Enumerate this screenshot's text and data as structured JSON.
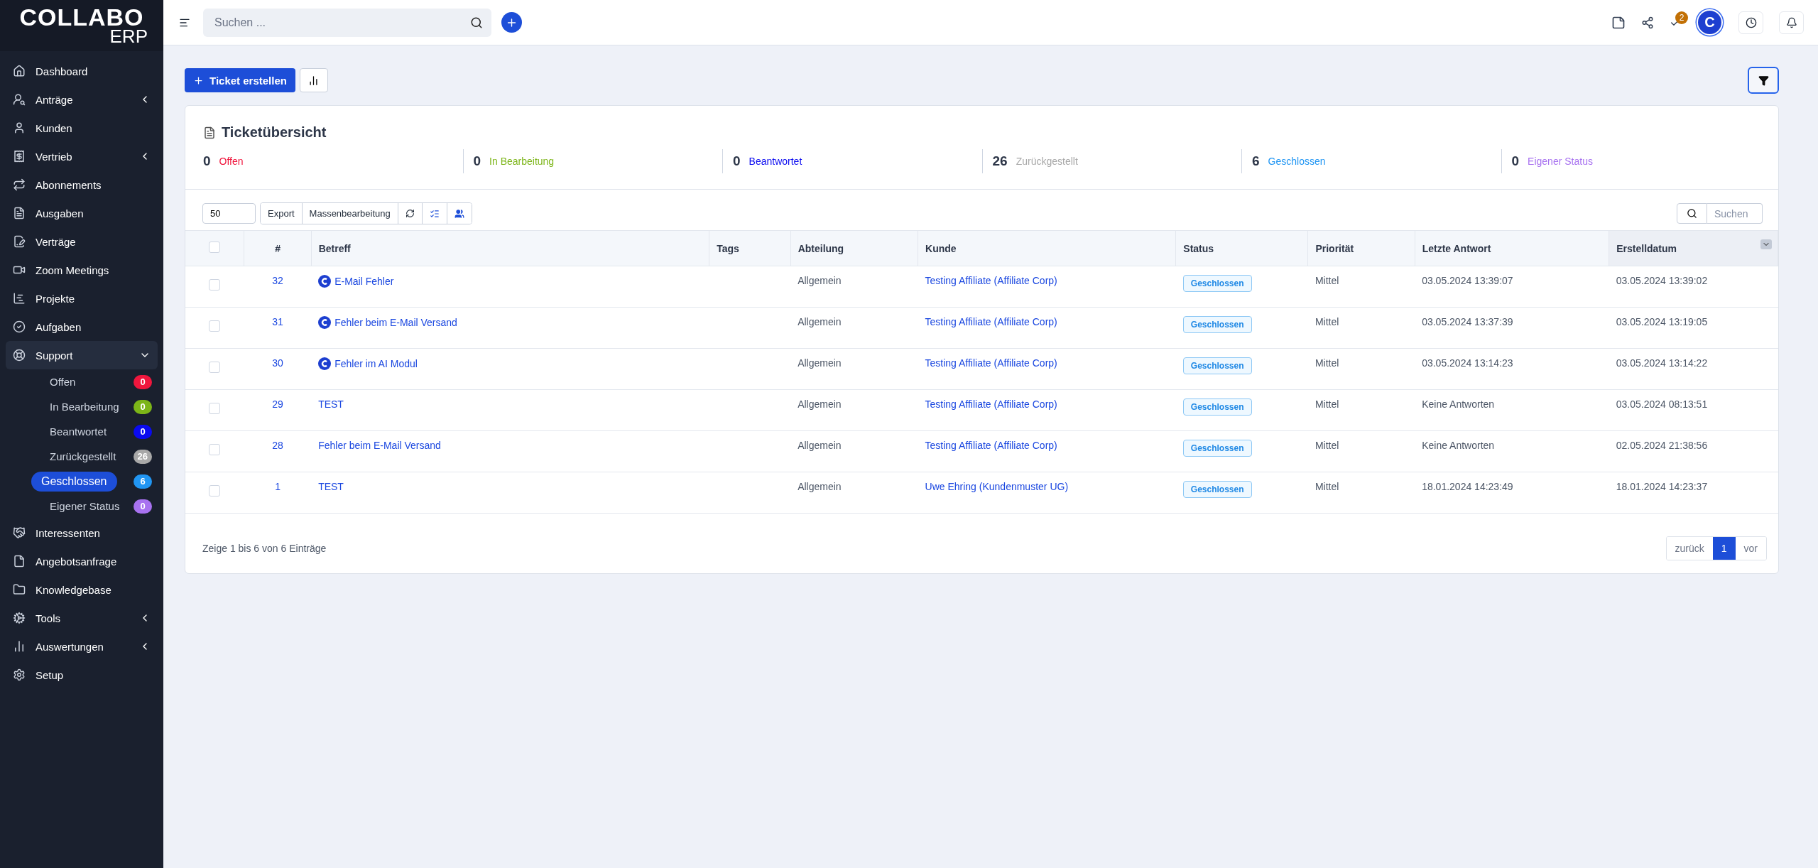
{
  "logo": {
    "main": "COLLABO",
    "sub": "ERP"
  },
  "sidebar": {
    "items": [
      {
        "label": "Dashboard",
        "kind": "link"
      },
      {
        "label": "Anträge",
        "kind": "group",
        "expanded": false
      },
      {
        "label": "Kunden",
        "kind": "link"
      },
      {
        "label": "Vertrieb",
        "kind": "group",
        "expanded": false
      },
      {
        "label": "Abonnements",
        "kind": "link"
      },
      {
        "label": "Ausgaben",
        "kind": "link"
      },
      {
        "label": "Verträge",
        "kind": "link"
      },
      {
        "label": "Zoom Meetings",
        "kind": "link"
      },
      {
        "label": "Projekte",
        "kind": "link"
      },
      {
        "label": "Aufgaben",
        "kind": "link"
      },
      {
        "label": "Support",
        "kind": "group",
        "expanded": true,
        "children": [
          {
            "label": "Offen",
            "badge": "0",
            "color": "#f0163d",
            "selected": false
          },
          {
            "label": "In Bearbeitung",
            "badge": "0",
            "color": "#7cb518",
            "selected": false
          },
          {
            "label": "Beantwortet",
            "badge": "0",
            "color": "#0a0af0",
            "selected": false
          },
          {
            "label": "Zurückgestellt",
            "badge": "26",
            "color": "#a8a8a8",
            "selected": false
          },
          {
            "label": "Geschlossen",
            "badge": "6",
            "color": "#2196f3",
            "selected": true
          },
          {
            "label": "Eigener Status",
            "badge": "0",
            "color": "#a872f0",
            "selected": false
          }
        ]
      },
      {
        "label": "Interessenten",
        "kind": "link"
      },
      {
        "label": "Angebotsanfrage",
        "kind": "link"
      },
      {
        "label": "Knowledgebase",
        "kind": "link"
      },
      {
        "label": "Tools",
        "kind": "group",
        "expanded": false
      },
      {
        "label": "Auswertungen",
        "kind": "group",
        "expanded": false
      },
      {
        "label": "Setup",
        "kind": "link"
      }
    ]
  },
  "topbar": {
    "search": {
      "placeholder": "Suchen ..."
    },
    "tasks_badge": "2",
    "avatar": "C"
  },
  "actions": {
    "create_button": "Ticket erstellen"
  },
  "overview": {
    "title": "Ticketübersicht",
    "stats": [
      {
        "count": "0",
        "label": "Offen",
        "color": "#f0163d"
      },
      {
        "count": "0",
        "label": "In Bearbeitung",
        "color": "#7cb518"
      },
      {
        "count": "0",
        "label": "Beantwortet",
        "color": "#0a0af0"
      },
      {
        "count": "26",
        "label": "Zurückgestellt",
        "color": "#a8a8a8"
      },
      {
        "count": "6",
        "label": "Geschlossen",
        "color": "#2196f3"
      },
      {
        "count": "0",
        "label": "Eigener Status",
        "color": "#a872f0"
      }
    ]
  },
  "toolbar": {
    "page_size": "50",
    "buttons": [
      "Export",
      "Massenbearbeitung"
    ],
    "search": {
      "placeholder": "Suchen"
    }
  },
  "table": {
    "all_checked": false,
    "columns": [
      "#",
      "Betreff",
      "Tags",
      "Abteilung",
      "Kunde",
      "Status",
      "Priorität",
      "Letzte Antwort",
      "Erstelldatum"
    ],
    "rows": [
      {
        "checked": false,
        "id": "32",
        "avatar": true,
        "subject": "E-Mail Fehler",
        "department": "Allgemein",
        "customer": "Testing Affiliate (Affiliate Corp)",
        "status": "Geschlossen",
        "priority": "Mittel",
        "last_reply": "03.05.2024 13:39:07",
        "created": "03.05.2024 13:39:02"
      },
      {
        "checked": false,
        "id": "31",
        "avatar": true,
        "subject": "Fehler beim E-Mail Versand",
        "department": "Allgemein",
        "customer": "Testing Affiliate (Affiliate Corp)",
        "status": "Geschlossen",
        "priority": "Mittel",
        "last_reply": "03.05.2024 13:37:39",
        "created": "03.05.2024 13:19:05"
      },
      {
        "checked": false,
        "id": "30",
        "avatar": true,
        "subject": "Fehler im AI Modul",
        "department": "Allgemein",
        "customer": "Testing Affiliate (Affiliate Corp)",
        "status": "Geschlossen",
        "priority": "Mittel",
        "last_reply": "03.05.2024 13:14:23",
        "created": "03.05.2024 13:14:22"
      },
      {
        "checked": false,
        "id": "29",
        "avatar": false,
        "subject": "TEST",
        "department": "Allgemein",
        "customer": "Testing Affiliate (Affiliate Corp)",
        "status": "Geschlossen",
        "priority": "Mittel",
        "last_reply": "Keine Antworten",
        "created": "03.05.2024 08:13:51"
      },
      {
        "checked": false,
        "id": "28",
        "avatar": false,
        "subject": "Fehler beim E-Mail Versand",
        "department": "Allgemein",
        "customer": "Testing Affiliate (Affiliate Corp)",
        "status": "Geschlossen",
        "priority": "Mittel",
        "last_reply": "Keine Antworten",
        "created": "02.05.2024 21:38:56"
      },
      {
        "checked": false,
        "id": "1",
        "avatar": false,
        "subject": "TEST",
        "department": "Allgemein",
        "customer": "Uwe Ehring (Kundenmuster UG)",
        "status": "Geschlossen",
        "priority": "Mittel",
        "last_reply": "18.01.2024 14:23:49",
        "created": "18.01.2024 14:23:37"
      }
    ]
  },
  "footer": {
    "info": "Zeige 1 bis 6 von 6 Einträge",
    "pagination": [
      {
        "label": "zurück",
        "selected": false
      },
      {
        "label": "1",
        "selected": true
      },
      {
        "label": "vor",
        "selected": false
      }
    ]
  }
}
